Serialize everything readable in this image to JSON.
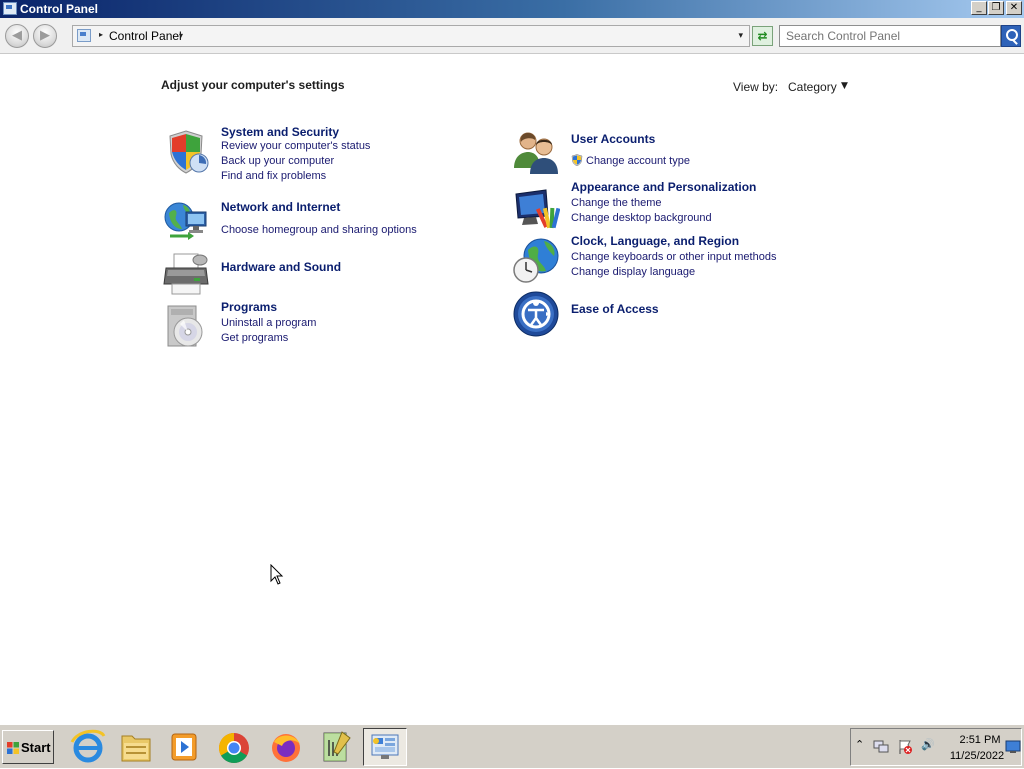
{
  "window": {
    "title": "Control Panel",
    "minimize_glyph": "_",
    "restore_glyph": "❐",
    "close_glyph": "✕"
  },
  "address": {
    "back_glyph": "◀",
    "forward_glyph": "▶",
    "separator_glyph": "▸",
    "breadcrumb": "Control Panel",
    "breadcrumb_arrow": "▾",
    "dropdown_glyph": "▾",
    "refresh_glyph": "⇄",
    "search_placeholder": "Search Control Panel"
  },
  "main": {
    "heading": "Adjust your computer's settings",
    "view_by_label": "View by:",
    "view_by_value": "Category",
    "view_by_arrow": "▼"
  },
  "categories_left": [
    {
      "title": "System and Security",
      "icon": "shield-icon",
      "links": [
        "Review your computer's status",
        "Back up your computer",
        "Find and fix problems"
      ]
    },
    {
      "title": "Network and Internet",
      "icon": "network-globe-icon",
      "links": [
        "Choose homegroup and sharing options"
      ]
    },
    {
      "title": "Hardware and Sound",
      "icon": "printer-icon",
      "links": []
    },
    {
      "title": "Programs",
      "icon": "programs-disc-icon",
      "links": [
        "Uninstall a program",
        "Get programs"
      ]
    }
  ],
  "categories_right": [
    {
      "title": "User Accounts",
      "icon": "users-icon",
      "links": [
        "Change account type"
      ]
    },
    {
      "title": "Appearance and Personalization",
      "icon": "monitor-paint-icon",
      "links": [
        "Change the theme",
        "Change desktop background"
      ]
    },
    {
      "title": "Clock, Language, and Region",
      "icon": "globe-clock-icon",
      "links": [
        "Change keyboards or other input methods",
        "Change display language"
      ]
    },
    {
      "title": "Ease of Access",
      "icon": "ease-of-access-icon",
      "links": []
    }
  ],
  "taskbar": {
    "start_label": "Start",
    "apps": [
      "internet-explorer-icon",
      "file-explorer-icon",
      "media-player-icon",
      "chrome-icon",
      "firefox-icon",
      "notepad-plus-plus-icon",
      "control-panel-icon"
    ],
    "tray": {
      "expand_glyph": "⌃",
      "volume_glyph": "🔊",
      "time": "2:51 PM",
      "date": "11/25/2022"
    }
  },
  "colors": {
    "link": "#1a1a70",
    "title_link": "#0a1e6e",
    "titlebar_start": "#0a246a",
    "titlebar_end": "#a6caf0"
  }
}
